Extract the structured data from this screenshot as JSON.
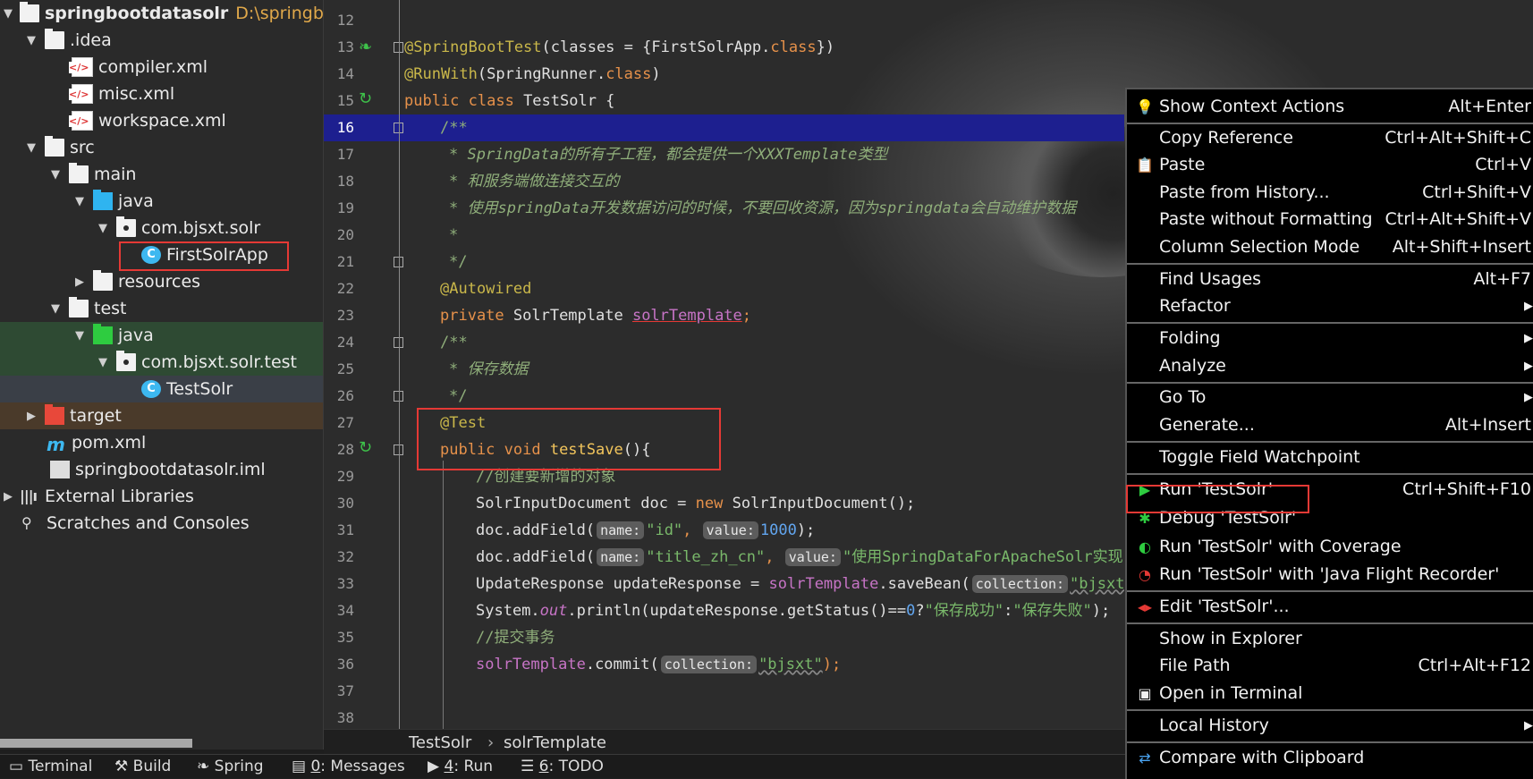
{
  "tree": {
    "project_name": "springbootdatasolr",
    "project_path": "D:\\springboot",
    "items": [
      {
        "label": "springbootdatasolr",
        "depth": 0,
        "arrow": "▼",
        "icon": "folder-white"
      },
      {
        "label": ".idea",
        "depth": 1,
        "arrow": "▼",
        "icon": "folder-white"
      },
      {
        "label": "compiler.xml",
        "depth": 2,
        "arrow": "",
        "icon": "xml-file"
      },
      {
        "label": "misc.xml",
        "depth": 2,
        "arrow": "",
        "icon": "xml-file"
      },
      {
        "label": "workspace.xml",
        "depth": 2,
        "arrow": "",
        "icon": "xml-file"
      },
      {
        "label": "src",
        "depth": 1,
        "arrow": "▼",
        "icon": "folder-white"
      },
      {
        "label": "main",
        "depth": 2,
        "arrow": "▼",
        "icon": "folder-white"
      },
      {
        "label": "java",
        "depth": 3,
        "arrow": "▼",
        "icon": "folder-blue"
      },
      {
        "label": "com.bjsxt.solr",
        "depth": 4,
        "arrow": "▼",
        "icon": "package"
      },
      {
        "label": "FirstSolrApp",
        "depth": 5,
        "arrow": "",
        "icon": "class"
      },
      {
        "label": "resources",
        "depth": 3,
        "arrow": "▶",
        "icon": "folder-white"
      },
      {
        "label": "test",
        "depth": 2,
        "arrow": "▼",
        "icon": "folder-white"
      },
      {
        "label": "java",
        "depth": 3,
        "arrow": "▼",
        "icon": "folder-green"
      },
      {
        "label": "com.bjsxt.solr.test",
        "depth": 4,
        "arrow": "▼",
        "icon": "package"
      },
      {
        "label": "TestSolr",
        "depth": 5,
        "arrow": "",
        "icon": "class"
      },
      {
        "label": "target",
        "depth": 1,
        "arrow": "▶",
        "icon": "folder-red"
      },
      {
        "label": "pom.xml",
        "depth": 1,
        "arrow": "",
        "icon": "maven"
      },
      {
        "label": "springbootdatasolr.iml",
        "depth": 1,
        "arrow": "",
        "icon": "file"
      },
      {
        "label": "External Libraries",
        "depth": 0,
        "arrow": "▶",
        "icon": "libraries"
      },
      {
        "label": "Scratches and Consoles",
        "depth": 0,
        "arrow": "",
        "icon": "scratches"
      }
    ]
  },
  "editor": {
    "line_numbers": [
      "12",
      "13",
      "14",
      "15",
      "16",
      "17",
      "18",
      "19",
      "20",
      "21",
      "22",
      "23",
      "24",
      "25",
      "26",
      "27",
      "28",
      "29",
      "30",
      "31",
      "32",
      "33",
      "34",
      "35",
      "36",
      "37",
      "38"
    ],
    "line13": {
      "a": "@SpringBootTest",
      "b": "(classes = {FirstSolrApp.",
      "c": "class",
      "d": "})"
    },
    "line14": {
      "a": "@RunWith",
      "b": "(SpringRunner.",
      "c": "class",
      "d": ")"
    },
    "line15": {
      "a": "public class ",
      "b": "TestSolr {"
    },
    "line16": "/**",
    "line17": "* SpringData的所有子工程，都会提供一个XXXTemplate类型",
    "line18": "* 和服务端做连接交互的",
    "line19": "* 使用springData开发数据访问的时候，不要回收资源，因为springdata会自动维护数据",
    "line20": "*",
    "line21": "*/",
    "line22": "@Autowired",
    "line23": {
      "a": "private ",
      "b": "SolrTemplate ",
      "c": "solrTemplate",
      "d": ";"
    },
    "line24": "/**",
    "line25": "* 保存数据",
    "line26": "*/",
    "line27": "@Test",
    "line28": {
      "a": "public void ",
      "b": "testSave",
      "c": "(){"
    },
    "line29": "//创建要新增的对象",
    "line30": {
      "a": "SolrInputDocument doc = ",
      "b": "new ",
      "c": "SolrInputDocument();"
    },
    "line31": {
      "a": "doc.addField(",
      "h1": "name:",
      "s1": "\"id\"",
      "sep": ",",
      "h2": "value:",
      "n": "1000",
      "end": ");"
    },
    "line32": {
      "a": "doc.addField(",
      "h1": "name:",
      "s1": "\"title_zh_cn\"",
      "sep": ",",
      "h2": "value:",
      "s2": "\"使用SpringDataForApacheSolr实现"
    },
    "line33": {
      "a": "UpdateResponse updateResponse = ",
      "f": "solrTemplate",
      "b": ".saveBean(",
      "h": "collection:",
      "s": "\"bjsxt\"",
      "end": ","
    },
    "line34": {
      "a": "System.",
      "o": "out",
      "b": ".println(updateResponse.getStatus()==",
      "n": "0",
      "c": "?",
      "s1": "\"保存成功\"",
      "d": ":",
      "s2": "\"保存失败\"",
      "end": ");"
    },
    "line35": "//提交事务",
    "line36": {
      "f": "solrTemplate",
      "b": ".commit(",
      "h": "collection:",
      "s": "\"bjsxt\"",
      "end": ");"
    }
  },
  "breadcrumb": {
    "file": "TestSolr",
    "sep": "›",
    "member": "solrTemplate"
  },
  "statusbar": {
    "terminal": "Terminal",
    "build": "Build",
    "spring": "Spring",
    "messages_num": "0",
    "messages": ": Messages",
    "run_num": "4",
    "run": ": Run",
    "todo_num": "6",
    "todo": ": TODO"
  },
  "context_menu": {
    "items": [
      {
        "label": "Show Context Actions",
        "shortcut": "Alt+Enter",
        "icon": "bulb-icon"
      },
      {
        "label": "Copy Reference",
        "shortcut": "Ctrl+Alt+Shift+C"
      },
      {
        "label": "Paste",
        "shortcut": "Ctrl+V",
        "icon": "clipboard-icon"
      },
      {
        "label": "Paste from History...",
        "shortcut": "Ctrl+Shift+V"
      },
      {
        "label": "Paste without Formatting",
        "shortcut": "Ctrl+Alt+Shift+V"
      },
      {
        "label": "Column Selection Mode",
        "shortcut": "Alt+Shift+Insert"
      },
      {
        "label": "Find Usages",
        "shortcut": "Alt+F7"
      },
      {
        "label": "Refactor",
        "shortcut": "",
        "submenu": true
      },
      {
        "label": "Folding",
        "shortcut": "",
        "submenu": true
      },
      {
        "label": "Analyze",
        "shortcut": "",
        "submenu": true
      },
      {
        "label": "Go To",
        "shortcut": "",
        "submenu": true
      },
      {
        "label": "Generate...",
        "shortcut": "Alt+Insert"
      },
      {
        "label": "Toggle Field Watchpoint",
        "shortcut": ""
      },
      {
        "label": "Run 'TestSolr'",
        "shortcut": "Ctrl+Shift+F10",
        "icon": "run-icon"
      },
      {
        "label": "Debug 'TestSolr'",
        "shortcut": "",
        "icon": "debug-icon"
      },
      {
        "label": "Run 'TestSolr' with Coverage",
        "shortcut": "",
        "icon": "coverage-icon"
      },
      {
        "label": "Run 'TestSolr' with 'Java Flight Recorder'",
        "shortcut": "",
        "icon": "profiler-icon"
      },
      {
        "label": "Edit 'TestSolr'...",
        "shortcut": "",
        "icon": "edit-config-icon"
      },
      {
        "label": "Show in Explorer",
        "shortcut": ""
      },
      {
        "label": "File Path",
        "shortcut": "Ctrl+Alt+F12"
      },
      {
        "label": "Open in Terminal",
        "shortcut": "",
        "icon": "terminal-icon"
      },
      {
        "label": "Local History",
        "shortcut": "",
        "submenu": true
      },
      {
        "label": "Compare with Clipboard",
        "shortcut": "",
        "icon": "compare-icon"
      }
    ]
  }
}
